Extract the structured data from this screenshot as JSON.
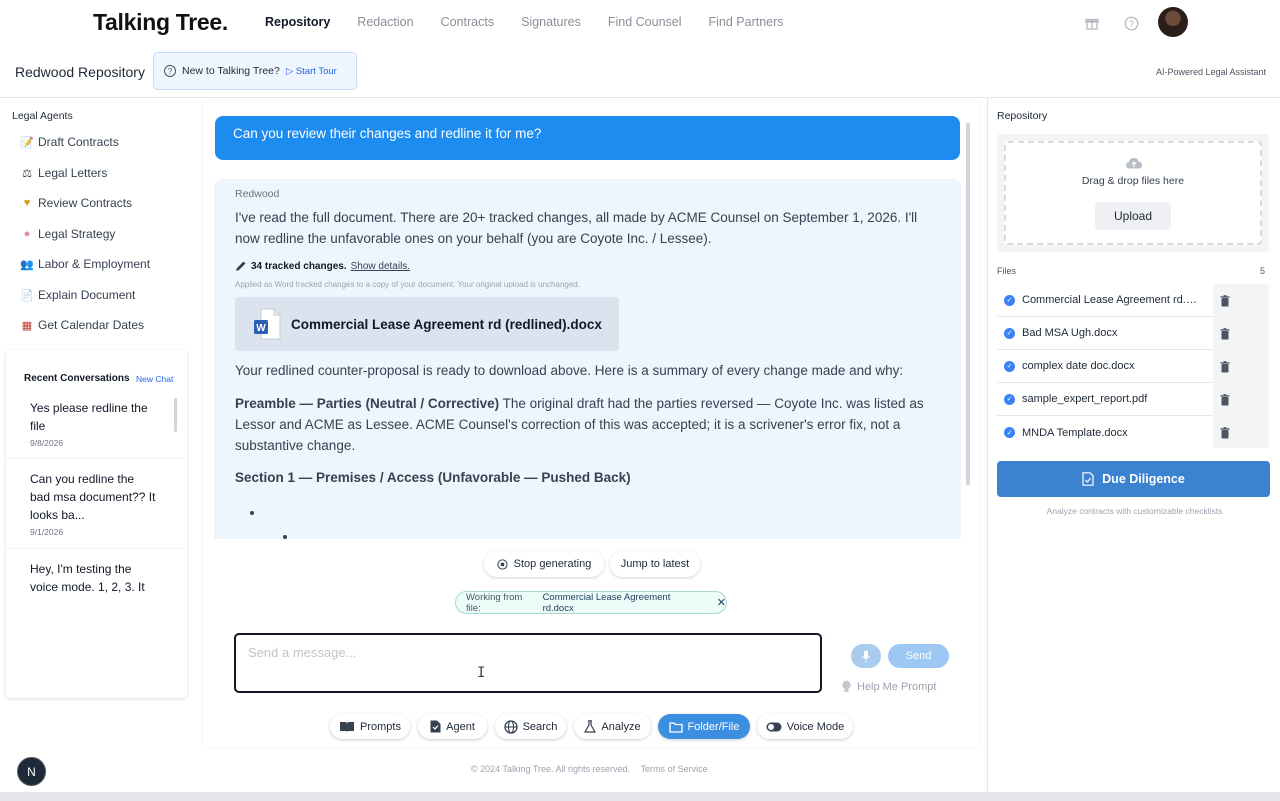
{
  "nav": {
    "brand": "Talking Tree.",
    "links": [
      "Repository",
      "Redaction",
      "Contracts",
      "Signatures",
      "Find Counsel",
      "Find Partners"
    ],
    "active": "Repository"
  },
  "subheader": {
    "title": "Redwood Repository",
    "tour_prompt": "New to Talking Tree?",
    "tour_action": "Start Tour",
    "ai_label": "AI-Powered Legal Assistant"
  },
  "sidebar": {
    "heading": "Legal Agents",
    "agents": [
      {
        "label": "Draft Contracts",
        "icon": "memo-icon"
      },
      {
        "label": "Legal Letters",
        "icon": "scales-icon"
      },
      {
        "label": "Review Contracts",
        "icon": "heart-hands-icon"
      },
      {
        "label": "Legal Strategy",
        "icon": "brain-icon"
      },
      {
        "label": "Labor & Employment",
        "icon": "people-icon"
      },
      {
        "label": "Explain Document",
        "icon": "document-icon"
      },
      {
        "label": "Get Calendar Dates",
        "icon": "calendar-icon"
      }
    ],
    "recent_heading": "Recent Conversations",
    "new_chat": "New Chat",
    "conversations": [
      {
        "line1": "Yes please redline the",
        "line2": "file",
        "line3": "",
        "date": "9/8/2026"
      },
      {
        "line1": "Can you redline the",
        "line2": "bad msa document?? It",
        "line3": "looks ba...",
        "date": "9/1/2026"
      },
      {
        "line1": "Hey, I'm testing the",
        "line2": "voice mode. 1, 2, 3. It",
        "line3": "",
        "date": ""
      }
    ]
  },
  "chat": {
    "user_message": "Can you review their changes and redline it for me?",
    "assistant_name": "Redwood",
    "intro_line1": "I've read the full document. There are 20+ tracked changes, all made by ACME Counsel on September 1, 2026. I'll",
    "intro_line2": "now redline the unfavorable ones on your behalf (you are Coyote Inc. / Lessee).",
    "tracked_count": "34 tracked changes.",
    "show_details": "Show details.",
    "applied_note": "Applied as Word tracked changes to a copy of your document. Your original upload is unchanged.",
    "doc_name": "Commercial Lease Agreement rd (redlined).docx",
    "summary_line": "Your redlined counter-proposal is ready to download above. Here is a summary of every change made and why:",
    "preamble_head": "Preamble — Parties (Neutral / Corrective)",
    "preamble_l1": " The original draft had the parties reversed — Coyote Inc. was listed as",
    "preamble_l2": "Lessor and ACME as Lessee. ACME Counsel's correction of this was accepted; it is a scrivener's error fix, not a",
    "preamble_l3": "substantive change.",
    "section1_head": "Section 1 — Premises / Access (Unfavorable — Pushed Back)",
    "stop_label": "Stop generating",
    "jump_label": "Jump to latest",
    "working_prefix": "Working from file:",
    "working_file": "Commercial Lease Agreement rd.docx",
    "input_placeholder": "Send a message...",
    "send_label": "Send",
    "help_prompt": "Help Me Prompt",
    "tools": [
      "Prompts",
      "Agent",
      "Search",
      "Analyze",
      "Folder/File",
      "Voice Mode"
    ],
    "active_tool": "Folder/File"
  },
  "footer": {
    "copyright": "© 2024 Talking Tree. All rights reserved.",
    "terms": "Terms of Service"
  },
  "repository_panel": {
    "title": "Repository",
    "drop_text": "Drag & drop files here",
    "upload_label": "Upload",
    "files_label": "Files",
    "files_count": "5",
    "files": [
      "Commercial Lease Agreement rd.docx",
      "Bad MSA Ugh.docx",
      "complex date doc.docx",
      "sample_expert_report.pdf",
      "MNDA Template.docx"
    ],
    "due_diligence": "Due Diligence",
    "due_diligence_sub": "Analyze contracts with customizable checklists"
  },
  "badge": "N",
  "colors": {
    "accent": "#1d8cf0",
    "assistant_bg": "#eef5fd",
    "due_diligence": "#3b82d0"
  }
}
